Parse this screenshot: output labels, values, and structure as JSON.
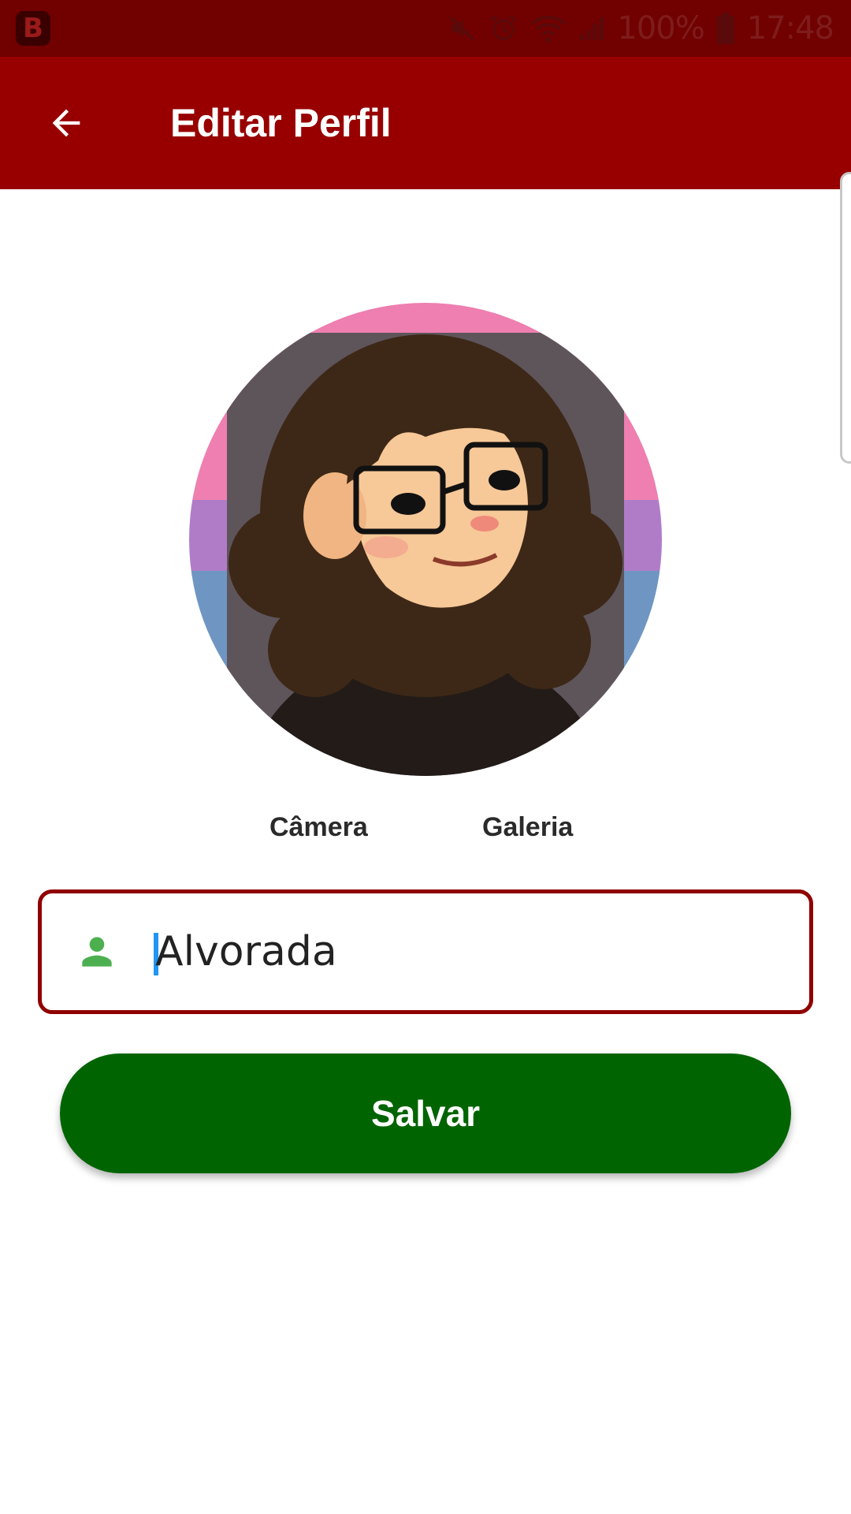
{
  "status_bar": {
    "app_icon_letter": "B",
    "icons": [
      "mute-icon",
      "alarm-icon",
      "wifi-icon",
      "signal-icon"
    ],
    "battery": "100%",
    "time": "17:48"
  },
  "app_bar": {
    "back_icon": "arrow-back-icon",
    "title": "Editar Perfil"
  },
  "profile": {
    "avatar_alt": "profile illustration",
    "camera_label": "Câmera",
    "gallery_label": "Galeria"
  },
  "name_field": {
    "icon": "person-icon",
    "value": "Alvorada"
  },
  "save_label": "Salvar",
  "colors": {
    "status_bar": "#710000",
    "app_bar": "#980000",
    "field_border": "#8f0000",
    "save_button": "#006400",
    "person_icon": "#4caf50",
    "cursor": "#2196f3"
  }
}
